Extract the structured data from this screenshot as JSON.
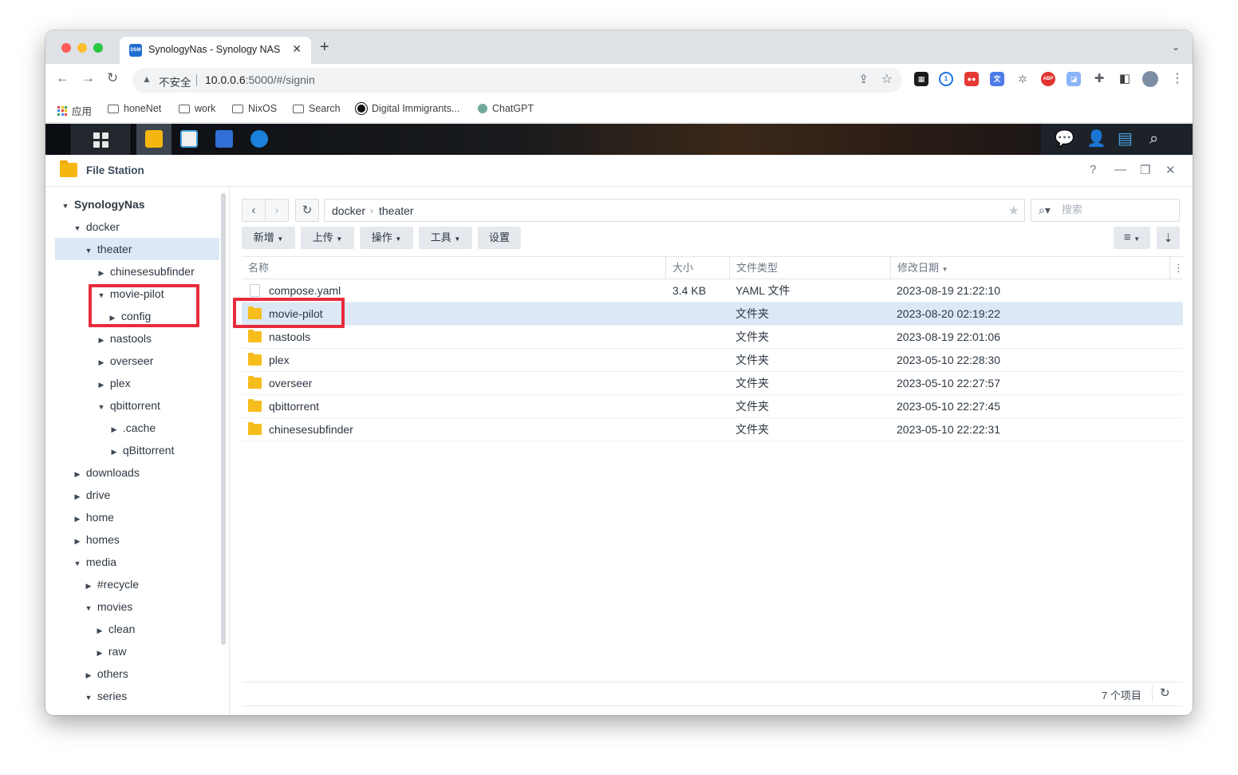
{
  "browser": {
    "tab_title": "SynologyNas - Synology NAS",
    "favicon_text": "DSM",
    "tab_close": "✕",
    "new_tab": "+",
    "tab_menu": "⌄",
    "insecure_label": "不安全",
    "url_host": "10.0.0.6",
    "url_rest": ":5000/#/signin"
  },
  "bookmarks": [
    {
      "label": "应用",
      "type": "apps"
    },
    {
      "label": "honeNet",
      "type": "folder"
    },
    {
      "label": "work",
      "type": "folder"
    },
    {
      "label": "NixOS",
      "type": "folder"
    },
    {
      "label": "Search",
      "type": "folder"
    },
    {
      "label": "Digital Immigrants...",
      "type": "site"
    },
    {
      "label": "ChatGPT",
      "type": "site"
    }
  ],
  "window": {
    "app_title": "File Station",
    "help": "?",
    "minimize": "—",
    "restore": "❐",
    "close": "✕"
  },
  "tree": {
    "root": "SynologyNas",
    "items": [
      {
        "label": "docker",
        "expanded": true
      },
      {
        "label": "theater",
        "expanded": true,
        "selected": true
      },
      {
        "label": "chinesesubfinder",
        "expanded": false
      },
      {
        "label": "movie-pilot",
        "expanded": true
      },
      {
        "label": "config",
        "expanded": false
      },
      {
        "label": "nastools",
        "expanded": false
      },
      {
        "label": "overseer",
        "expanded": false
      },
      {
        "label": "plex",
        "expanded": false
      },
      {
        "label": "qbittorrent",
        "expanded": true
      },
      {
        "label": ".cache",
        "expanded": false
      },
      {
        "label": "qBittorrent",
        "expanded": false
      },
      {
        "label": "downloads",
        "expanded": false
      },
      {
        "label": "drive",
        "expanded": false
      },
      {
        "label": "home",
        "expanded": false
      },
      {
        "label": "homes",
        "expanded": false
      },
      {
        "label": "media",
        "expanded": true
      },
      {
        "label": "#recycle",
        "expanded": false
      },
      {
        "label": "movies",
        "expanded": true
      },
      {
        "label": "clean",
        "expanded": false
      },
      {
        "label": "raw",
        "expanded": false
      },
      {
        "label": "others",
        "expanded": false
      },
      {
        "label": "series",
        "expanded": true
      }
    ]
  },
  "path": {
    "segments": [
      "docker",
      "theater"
    ],
    "separator": "›"
  },
  "search": {
    "placeholder": "搜索"
  },
  "actions": {
    "new": "新增",
    "upload": "上传",
    "action": "操作",
    "tools": "工具",
    "settings": "设置"
  },
  "table": {
    "columns": {
      "name": "名称",
      "size": "大小",
      "type": "文件类型",
      "modified": "修改日期"
    },
    "rows": [
      {
        "name": "compose.yaml",
        "size": "3.4 KB",
        "type": "YAML 文件",
        "modified": "2023-08-19 21:22:10",
        "kind": "file"
      },
      {
        "name": "movie-pilot",
        "size": "",
        "type": "文件夹",
        "modified": "2023-08-20 02:19:22",
        "kind": "folder",
        "selected": true
      },
      {
        "name": "nastools",
        "size": "",
        "type": "文件夹",
        "modified": "2023-08-19 22:01:06",
        "kind": "folder"
      },
      {
        "name": "plex",
        "size": "",
        "type": "文件夹",
        "modified": "2023-05-10 22:28:30",
        "kind": "folder"
      },
      {
        "name": "overseer",
        "size": "",
        "type": "文件夹",
        "modified": "2023-05-10 22:27:57",
        "kind": "folder"
      },
      {
        "name": "qbittorrent",
        "size": "",
        "type": "文件夹",
        "modified": "2023-05-10 22:27:45",
        "kind": "folder"
      },
      {
        "name": "chinesesubfinder",
        "size": "",
        "type": "文件夹",
        "modified": "2023-05-10 22:22:31",
        "kind": "folder"
      }
    ]
  },
  "status": {
    "item_count": "7 个项目"
  },
  "colors": {
    "highlight_border": "#e82c3c",
    "selection": "#dce8f6",
    "folder": "#f6bd1d"
  }
}
